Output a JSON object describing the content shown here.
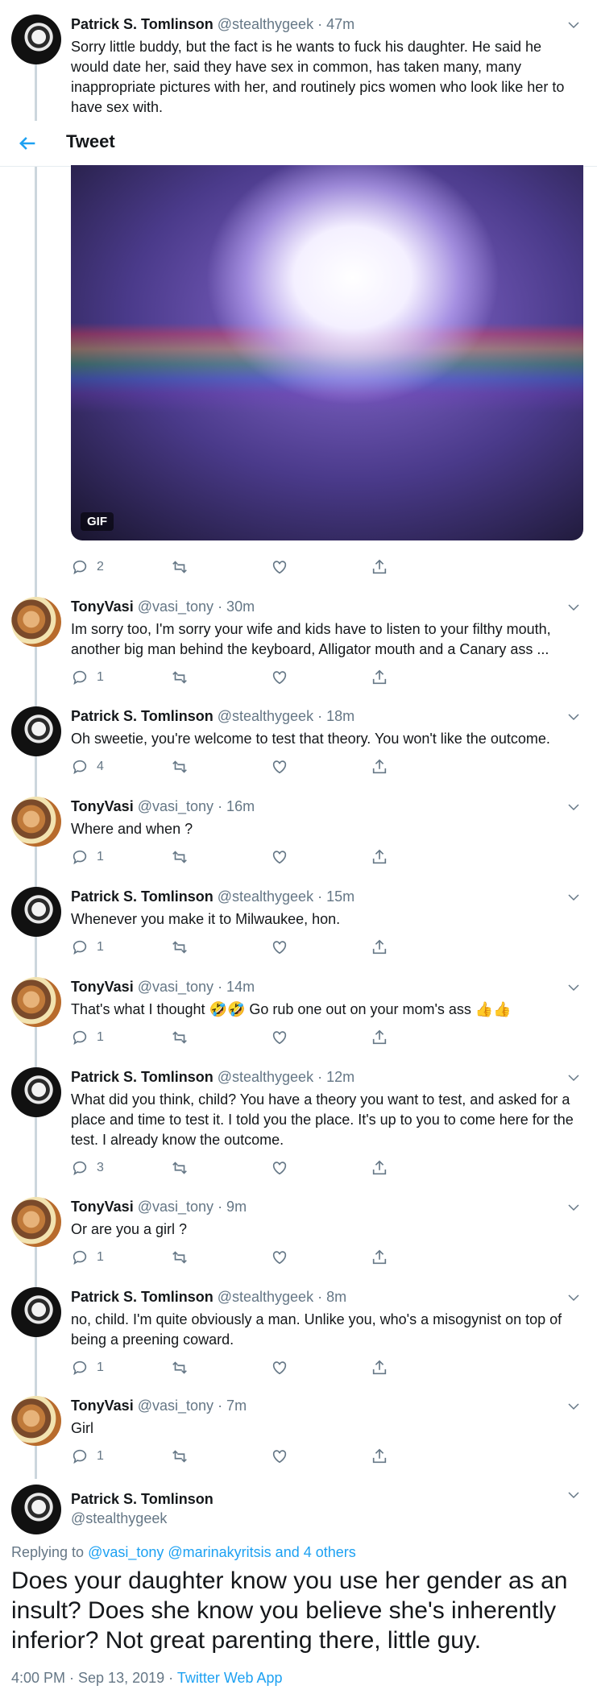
{
  "topbar": {
    "title": "Tweet"
  },
  "tweets": [
    {
      "name": "Patrick S. Tomlinson",
      "handle": "@stealthygeek",
      "time": "· 47m",
      "text": "Sorry little buddy, but the fact is he wants to fuck his daughter. He said he would date her, said they have sex in common, has taken many, many inappropriate pictures with her, and routinely pics women who look like her to have sex with.",
      "replies": "",
      "gif_label": "GIF",
      "replies2": "2"
    },
    {
      "name": "TonyVasi",
      "handle": "@vasi_tony",
      "time": "· 30m",
      "text": "Im sorry too, I'm sorry your wife and kids have to listen to your filthy mouth, another big man behind the keyboard, Alligator mouth and a Canary ass ...",
      "replies": "1"
    },
    {
      "name": "Patrick S. Tomlinson",
      "handle": "@stealthygeek",
      "time": "· 18m",
      "text": "Oh sweetie, you're welcome to test that theory. You won't like the outcome.",
      "replies": "4"
    },
    {
      "name": "TonyVasi",
      "handle": "@vasi_tony",
      "time": "· 16m",
      "text": "Where and when ?",
      "replies": "1"
    },
    {
      "name": "Patrick S. Tomlinson",
      "handle": "@stealthygeek",
      "time": "· 15m",
      "text": "Whenever you make it to Milwaukee, hon.",
      "replies": "1"
    },
    {
      "name": "TonyVasi",
      "handle": "@vasi_tony",
      "time": "· 14m",
      "text": "That's what I thought 🤣🤣 Go rub one out on your mom's ass 👍👍",
      "replies": "1"
    },
    {
      "name": "Patrick S. Tomlinson",
      "handle": "@stealthygeek",
      "time": "· 12m",
      "text": "What did you think, child? You have a theory you want to test, and asked for a place and time to test it. I told you the place. It's up to you to come here for the test. I already know the outcome.",
      "replies": "3"
    },
    {
      "name": "TonyVasi",
      "handle": "@vasi_tony",
      "time": "· 9m",
      "text": "Or are you a girl ?",
      "replies": "1"
    },
    {
      "name": "Patrick S. Tomlinson",
      "handle": "@stealthygeek",
      "time": "· 8m",
      "text": "no, child. I'm quite obviously a man. Unlike you, who's a misogynist on top of being a preening coward.",
      "replies": "1"
    },
    {
      "name": "TonyVasi",
      "handle": "@vasi_tony",
      "time": "· 7m",
      "text": "Girl",
      "replies": "1"
    }
  ],
  "main_tweet": {
    "name": "Patrick S. Tomlinson",
    "handle": "@stealthygeek",
    "replying_label": "Replying to",
    "replying_links": "@vasi_tony @marinakyritsis and 4 others",
    "text": "Does your daughter know you use her gender as an insult? Does she know you believe she's inherently inferior? Not great parenting there, little guy.",
    "timestamp": "4:00 PM · Sep 13, 2019 ·",
    "client": "Twitter Web App"
  },
  "colors": {
    "accent": "#1da1f2",
    "muted": "#657786",
    "line": "#ccd6dd"
  }
}
